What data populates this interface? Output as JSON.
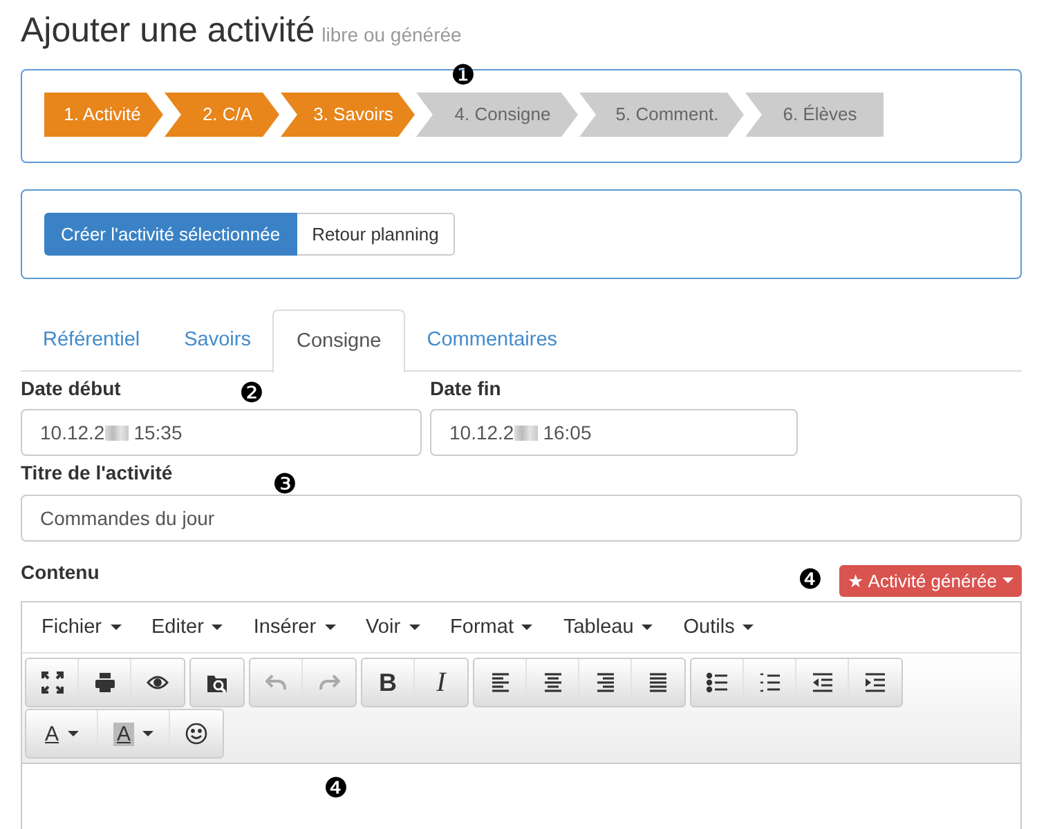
{
  "header": {
    "title": "Ajouter une activité",
    "subtitle": "libre ou générée"
  },
  "steps": [
    {
      "label": "1. Activité",
      "done": true
    },
    {
      "label": "2. C/A",
      "done": true
    },
    {
      "label": "3. Savoirs",
      "done": true
    },
    {
      "label": "4. Consigne",
      "done": false
    },
    {
      "label": "5. Comment.",
      "done": false
    },
    {
      "label": "6. Élèves",
      "done": false
    }
  ],
  "actions": [
    {
      "label": "Créer l'activité sélectionnée",
      "kind": "primary"
    },
    {
      "label": "Retour planning",
      "kind": "default"
    }
  ],
  "tabs": [
    {
      "label": "Référentiel",
      "selected": false
    },
    {
      "label": "Savoirs",
      "selected": false
    },
    {
      "label": "Consigne",
      "selected": true
    },
    {
      "label": "Commentaires",
      "selected": false
    }
  ],
  "date_start": {
    "label": "Date début",
    "value_start": "10.12.2",
    "value_end": "15:35"
  },
  "date_end": {
    "label": "Date fin",
    "value_start": "10.12.2",
    "value_end": "16:05"
  },
  "title_field": {
    "label": "Titre de l'activité",
    "value": "Commandes du jour"
  },
  "content": {
    "label": "Contenu",
    "badge": "Activité générée",
    "badge_icon": "★"
  },
  "menu": [
    "Fichier",
    "Editer",
    "Insérer",
    "Voir",
    "Format",
    "Tableau",
    "Outils"
  ],
  "toolbar": [
    [
      [
        {
          "kind": "fullscreen",
          "disabled": false
        },
        {
          "kind": "print",
          "disabled": false
        },
        {
          "kind": "preview",
          "disabled": false
        }
      ],
      [
        {
          "kind": "search",
          "disabled": false
        }
      ],
      [
        {
          "kind": "undo",
          "disabled": true
        },
        {
          "kind": "redo",
          "disabled": true
        }
      ],
      [
        {
          "kind": "bold",
          "label": "B",
          "disabled": false
        },
        {
          "kind": "italic",
          "label": "I",
          "disabled": false
        }
      ],
      [
        {
          "kind": "alignleft",
          "disabled": false
        },
        {
          "kind": "aligncenter",
          "disabled": false
        },
        {
          "kind": "alignright",
          "disabled": false
        },
        {
          "kind": "justify",
          "disabled": false
        }
      ],
      [
        {
          "kind": "bullist",
          "disabled": false
        },
        {
          "kind": "numlist",
          "disabled": false
        },
        {
          "kind": "outdent",
          "disabled": false
        },
        {
          "kind": "indent",
          "disabled": false
        }
      ]
    ],
    [
      [
        {
          "kind": "forecolor",
          "label": "A",
          "disabled": false
        },
        {
          "kind": "backcolor",
          "label": "A",
          "disabled": false
        },
        {
          "kind": "emoticon",
          "disabled": false
        }
      ]
    ]
  ],
  "callouts": [
    "❶",
    "❷",
    "❸",
    "❹",
    "❹"
  ]
}
